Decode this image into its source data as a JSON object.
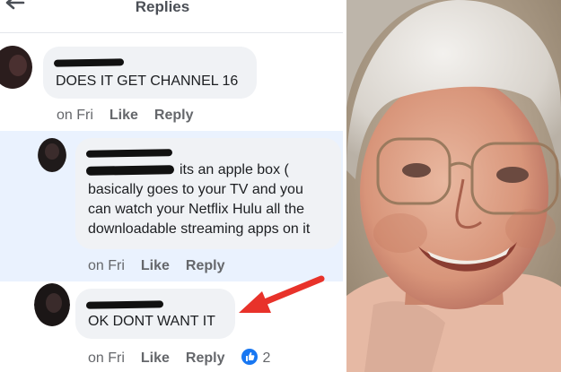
{
  "header": {
    "title": "Replies",
    "back_icon": "back-arrow-icon"
  },
  "comments": [
    {
      "text": "DOES IT GET CHANNEL 16",
      "time": "on Fri",
      "like": "Like",
      "reply": "Reply"
    },
    {
      "text_line1": "its an apple box (",
      "text_line2": "basically goes to your TV and you",
      "text_line3": "can watch your Netflix Hulu all the",
      "text_line4": "downloadable streaming apps on it",
      "time": "on Fri",
      "like": "Like",
      "reply": "Reply"
    },
    {
      "text": "OK DONT WANT IT",
      "time": "on Fri",
      "like": "Like",
      "reply": "Reply",
      "reaction_icon": "like-reaction-icon",
      "reaction_count": "2"
    }
  ],
  "colors": {
    "bubble": "#f0f2f5",
    "highlight_band": "#eaf2fe",
    "annotation_arrow": "#e8322a",
    "like_blue": "#1877f2"
  },
  "annotation": {
    "icon": "red-arrow-icon"
  },
  "photo": {
    "subject": "smiling-elderly-woman-with-glasses-image"
  }
}
